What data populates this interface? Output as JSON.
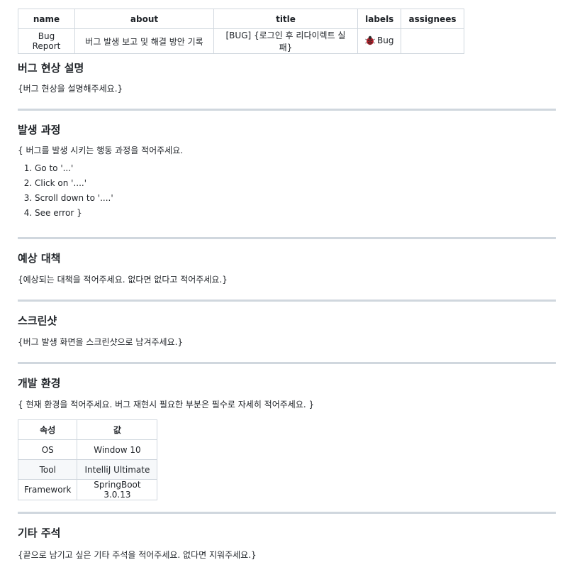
{
  "meta_table": {
    "headers": [
      "name",
      "about",
      "title",
      "labels",
      "assignees"
    ],
    "row": {
      "name": "Bug Report",
      "about": "버그 발생 보고 및 해결 방안 기록",
      "title": "[BUG] {로그인 후 리다이렉트 실패}",
      "label_icon": "ladybug-icon",
      "label": "Bug",
      "assignees": ""
    }
  },
  "sections": {
    "bug_description": {
      "heading": "버그 현상 설명",
      "text": "{버그 현상을 설명해주세요.}"
    },
    "reproduce": {
      "heading": "발생 과정",
      "text": "{ 버그를 발생 시키는 행동 과정을 적어주세요.",
      "steps": [
        "Go to '...'",
        "Click on '....'",
        "Scroll down to '....'",
        "See error }"
      ]
    },
    "solution": {
      "heading": "예상 대책",
      "text": "{예상되는 대책을 적어주세요. 없다면 없다고 적어주세요.}"
    },
    "screenshot": {
      "heading": "스크린샷",
      "text": "{버그 발생 화면을 스크린샷으로 남겨주세요.}"
    },
    "environment": {
      "heading": "개발 환경",
      "text": "{ 현재 환경을 적어주세요. 버그 재현시 필요한 부분은 필수로 자세히 적어주세요. }",
      "table_headers": [
        "속성",
        "값"
      ],
      "rows": [
        {
          "key": "OS",
          "value": "Window 10"
        },
        {
          "key": "Tool",
          "value": "IntelliJ Ultimate"
        },
        {
          "key": "Framework",
          "value": "SpringBoot 3.0.13"
        }
      ]
    },
    "notes": {
      "heading": "기타 주석",
      "text": "{끝으로 남기고 싶은 기타 주석을 적어주세요. 없다면 지워주세요.}"
    }
  },
  "colors": {
    "text": "#1f2328",
    "border": "#d0d7de",
    "stripe": "#f6f8fa",
    "bug_icon": "#b31d28"
  }
}
